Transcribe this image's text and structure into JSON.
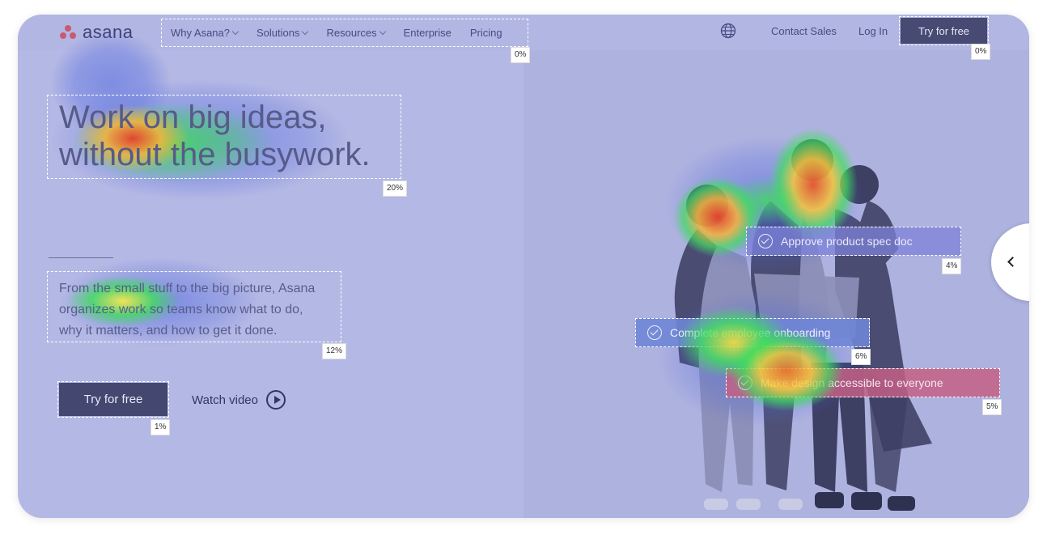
{
  "header": {
    "logo_text": "asana",
    "nav": [
      {
        "label": "Why Asana?",
        "has_dropdown": true
      },
      {
        "label": "Solutions",
        "has_dropdown": true
      },
      {
        "label": "Resources",
        "has_dropdown": true
      },
      {
        "label": "Enterprise",
        "has_dropdown": false
      },
      {
        "label": "Pricing",
        "has_dropdown": false
      }
    ],
    "nav_attention": "0%",
    "globe_icon": "globe-icon",
    "contact_sales": "Contact Sales",
    "log_in": "Log In",
    "try_button": "Try for free",
    "try_attention": "0%"
  },
  "hero": {
    "headline_line1": "Work on big ideas,",
    "headline_line2": "without the busywork.",
    "headline_attention": "20%",
    "para_line1": "From the small stuff to the big picture, Asana",
    "para_line2": "organizes work so teams know what to do,",
    "para_line3": "why it matters, and how to get it done.",
    "para_attention": "12%",
    "cta_label": "Try for free",
    "cta_attention": "1%",
    "watch_label": "Watch video"
  },
  "tasks": [
    {
      "label": "Approve product spec doc",
      "attention": "4%",
      "color": "#7e82d8"
    },
    {
      "label": "Complete employee onboarding",
      "attention": "6%",
      "color": "#6f86d6"
    },
    {
      "label": "Make design accessible to everyone",
      "attention": "5%",
      "color": "#c35f86"
    }
  ],
  "colors": {
    "background": "#b4b8e4",
    "dark_button": "#474a72",
    "heat_hot": "#e8402c",
    "heat_warm": "#f7d43a",
    "heat_mid": "#3fe05a",
    "heat_cool": "#4a63e0"
  },
  "carousel_icon": "chevron-left-icon"
}
